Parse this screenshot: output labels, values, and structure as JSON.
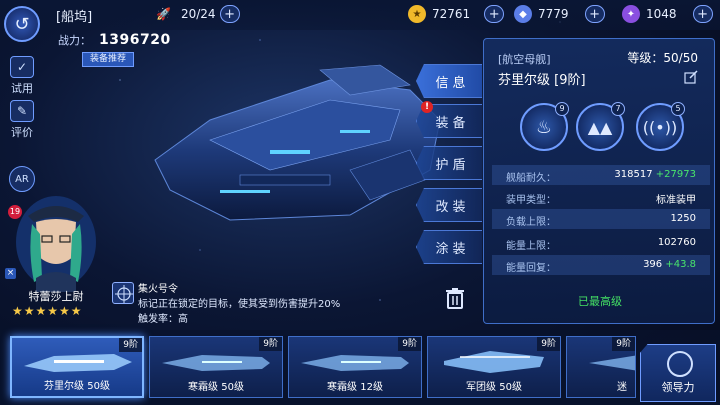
{
  "header": {
    "title": "[船坞]",
    "fleet_count": "20/24",
    "currencies": [
      {
        "name": "star-coin",
        "value": "72761"
      },
      {
        "name": "crystal",
        "value": "7779"
      },
      {
        "name": "gem",
        "value": "1048"
      }
    ]
  },
  "left_buttons": [
    {
      "label": "试用"
    },
    {
      "label": "评价"
    },
    {
      "label": "AR"
    }
  ],
  "power": {
    "label": "战力：",
    "value": "1396720",
    "recommend": "装备推荐"
  },
  "tabs": [
    {
      "label": "信息",
      "active": true
    },
    {
      "label": "装备",
      "alert": "!"
    },
    {
      "label": "护盾"
    },
    {
      "label": "改装"
    },
    {
      "label": "涂装"
    }
  ],
  "ship_panel": {
    "class": "[航空母舰]",
    "level": "等级：50/50",
    "name": "芬里尔级 [9阶]",
    "skills": [
      {
        "icon": "flame-icon",
        "level": "9"
      },
      {
        "icon": "fighters-icon",
        "level": "7"
      },
      {
        "icon": "signal-icon",
        "level": "5"
      }
    ],
    "stats": [
      {
        "label": "舰船耐久：",
        "value": "318517",
        "bonus": "+27973"
      },
      {
        "label": "装甲类型：",
        "value": "标准装甲",
        "bonus": ""
      },
      {
        "label": "负载上限：",
        "value": "1250",
        "bonus": ""
      },
      {
        "label": "能量上限：",
        "value": "102760",
        "bonus": ""
      },
      {
        "label": "能量回复：",
        "value": "396",
        "bonus": "+43.8"
      }
    ],
    "max_level": "已最高级"
  },
  "captain": {
    "level": "19",
    "name": "特蕾莎上尉",
    "stars": "★★★★★★",
    "close": "×",
    "skill_title": "集火号令",
    "skill_desc": "标记正在锁定的目标，使其受到伤害提升20%",
    "skill_trigger": "触发率：高"
  },
  "ship_cards": [
    {
      "name": "芬里尔级 50级",
      "tier": "9阶",
      "selected": true
    },
    {
      "name": "寒霜级 50级",
      "tier": "9阶",
      "selected": false
    },
    {
      "name": "寒霜级 12级",
      "tier": "9阶",
      "selected": false
    },
    {
      "name": "军团级 50级",
      "tier": "9阶",
      "selected": false
    },
    {
      "name": "迷",
      "tier": "9阶",
      "selected": false
    }
  ],
  "navigator": {
    "label": "领导力"
  },
  "colors": {
    "accent": "#3a6fd9",
    "bonus": "#48e66c",
    "max_level": "#44e064",
    "alert": "#e02424"
  }
}
